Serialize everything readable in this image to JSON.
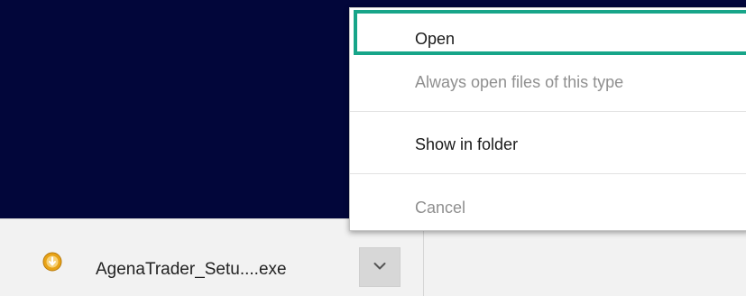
{
  "download_bar": {
    "file_name": "AgenaTrader_Setu....exe",
    "file_icon": "download-warning-icon",
    "dropdown_icon": "chevron-down-icon"
  },
  "context_menu": {
    "items": [
      {
        "label": "Open",
        "enabled": true
      },
      {
        "label": "Always open files of this type",
        "enabled": false
      },
      {
        "label": "Show in folder",
        "enabled": true
      },
      {
        "label": "Cancel",
        "enabled": false
      }
    ]
  },
  "colors": {
    "page_background": "#02063a",
    "highlight": "#17a589",
    "file_icon": "#e8a317"
  }
}
